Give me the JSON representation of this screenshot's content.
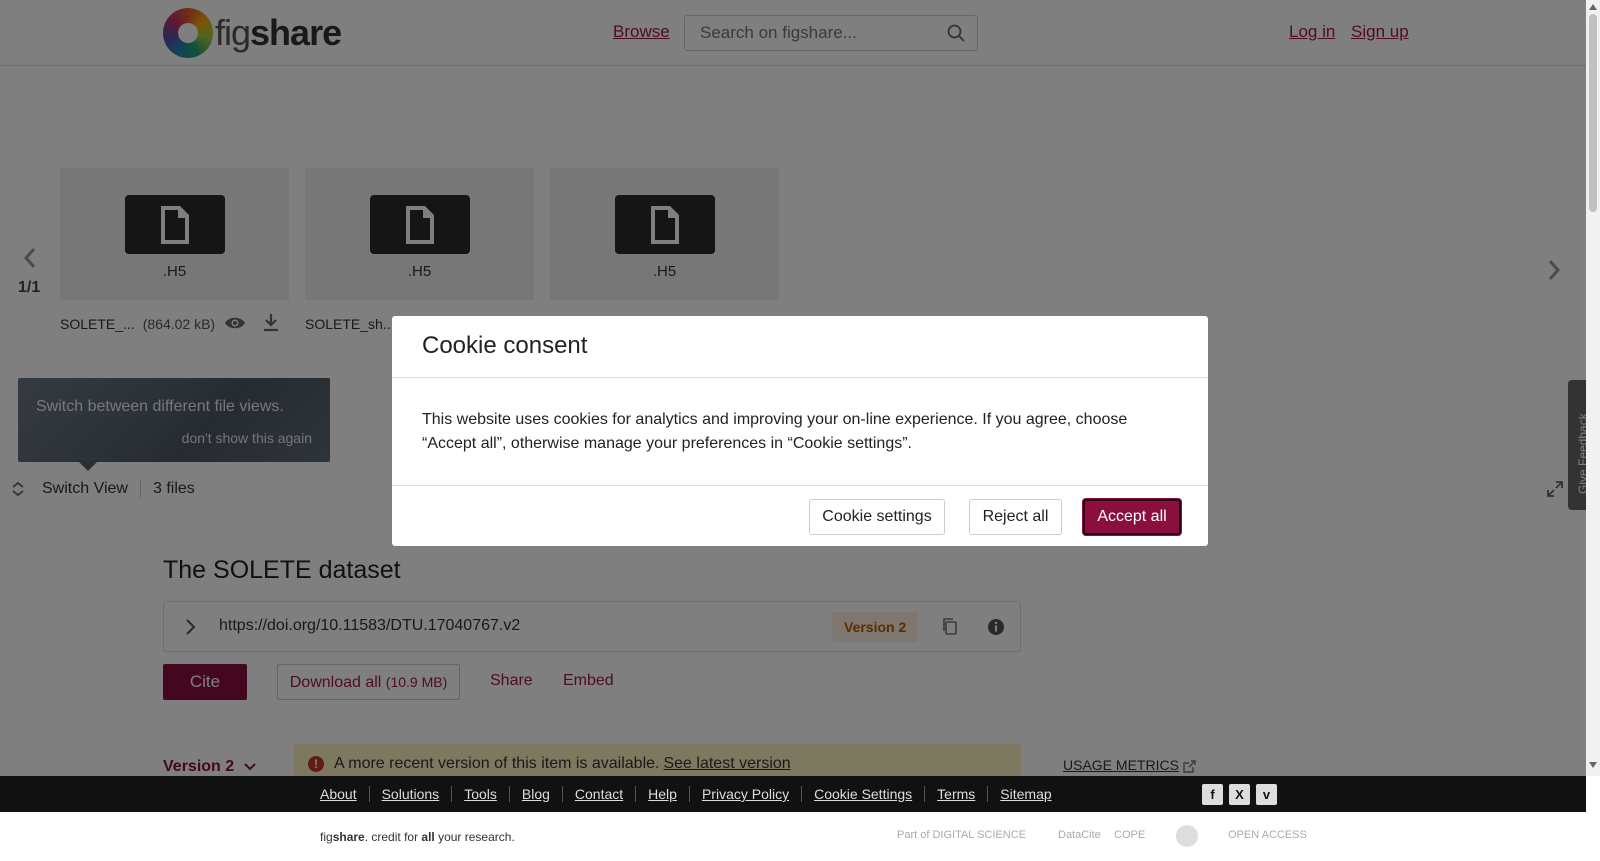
{
  "header": {
    "logo_text_light": "fig",
    "logo_text_bold": "share",
    "browse_label": "Browse",
    "search_placeholder": "Search on figshare...",
    "login_label": "Log in",
    "signup_label": "Sign up"
  },
  "viewer": {
    "page_indicator": "1/1",
    "files": [
      {
        "ext": ".H5",
        "name": "SOLETE_...",
        "size": "(864.02 kB)"
      },
      {
        "ext": ".H5",
        "name": "SOLETE_sh..."
      },
      {
        "ext": ".H5"
      }
    ],
    "tooltip_text": "Switch between different file views.",
    "tooltip_dismiss": "don't show this again",
    "switch_view_label": "Switch View",
    "file_count": "3 files",
    "feedback_label": "Give Feedback"
  },
  "item": {
    "title": "The SOLETE dataset",
    "doi": "https://doi.org/10.11583/DTU.17040767.v2",
    "version_badge": "Version 2",
    "cite_label": "Cite",
    "download_label": "Download all",
    "download_size": "(10.9 MB)",
    "share_label": "Share",
    "embed_label": "Embed",
    "version_select": "Version 2",
    "notice_text": "A more recent version of this item is available.",
    "notice_link": "See latest version",
    "usage_metrics": "USAGE METRICS"
  },
  "footer": {
    "links": [
      "About",
      "Solutions",
      "Tools",
      "Blog",
      "Contact",
      "Help",
      "Privacy Policy",
      "Cookie Settings",
      "Terms",
      "Sitemap"
    ],
    "tagline_fig": "fig",
    "tagline_share": "share",
    "tagline_mid": ". credit for ",
    "tagline_all": "all",
    "tagline_end": " your research.",
    "partners": [
      "Part of DIGITAL SCIENCE",
      "DataCite",
      "COPE",
      "OPEN ACCESS"
    ],
    "social": [
      "f",
      "X",
      "v"
    ]
  },
  "cookie_modal": {
    "title": "Cookie consent",
    "body": "This website uses cookies for analytics and improving your on-line experience. If you agree, choose “Accept all”, otherwise manage your preferences in “Cookie settings”.",
    "settings_label": "Cookie settings",
    "reject_label": "Reject all",
    "accept_label": "Accept all"
  },
  "colors": {
    "brand": "#8a0f3f",
    "link": "#a0164d",
    "badge_bg": "#fbeee0",
    "notice_bg": "#fbf3c0"
  }
}
